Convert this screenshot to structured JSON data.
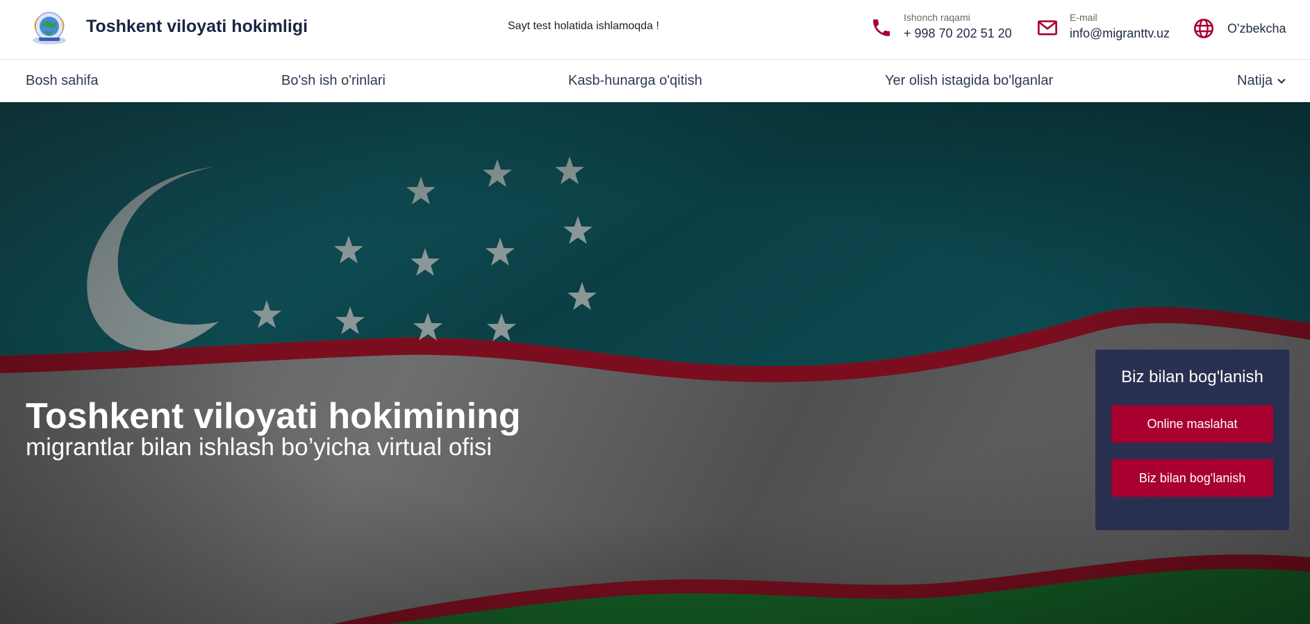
{
  "header": {
    "site_title": "Toshkent viloyati hokimligi",
    "test_notice": "Sayt test holatida ishlamoqda !",
    "phone": {
      "label": "Ishonch raqami",
      "value": "+ 998 70 202 51 20",
      "icon": "phone-icon"
    },
    "email": {
      "label": "E-mail",
      "value": "info@migranttv.uz",
      "icon": "mail-icon"
    },
    "language": {
      "label": "O'zbekcha",
      "icon": "globe-icon"
    }
  },
  "nav": {
    "items": [
      {
        "label": "Bosh sahifa"
      },
      {
        "label": "Bo'sh ish o'rinlari"
      },
      {
        "label": "Kasb-hunarga o'qitish"
      },
      {
        "label": "Yer olish istagida bo'lganlar"
      },
      {
        "label": "Natija",
        "icon": "chevron-down-icon"
      }
    ]
  },
  "hero": {
    "title": "Toshkent viloyati hokimining",
    "subtitle": "migrantlar bilan ishlash bo’yicha virtual ofisi"
  },
  "contact_panel": {
    "title": "Biz bilan bog'lanish",
    "buttons": [
      {
        "label": "Online maslahat"
      },
      {
        "label": "Biz bilan bog'lanish"
      }
    ]
  },
  "colors": {
    "accent": "#a8002f",
    "navy": "#1b2544",
    "panel": "#262c50",
    "flag_blue": "#0f5f66",
    "flag_white": "#8a8a8a",
    "flag_red": "#8a0d22",
    "flag_green": "#1c6a2a"
  }
}
